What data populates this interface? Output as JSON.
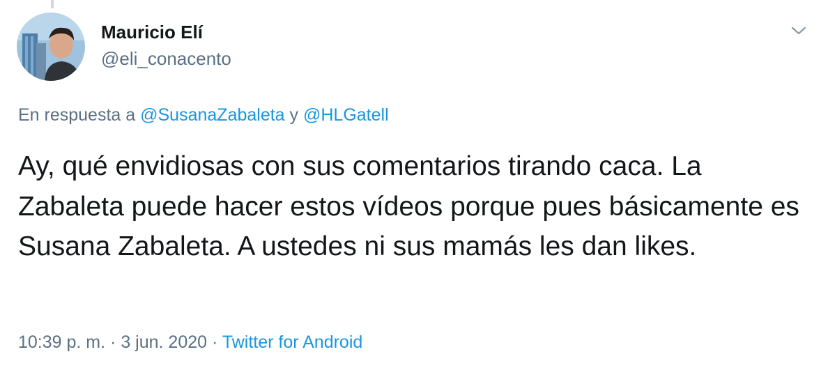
{
  "author": {
    "display_name": "Mauricio Elí",
    "handle": "@eli_conacento"
  },
  "reply": {
    "prefix": "En respuesta a",
    "mention_1": "@SusanaZabaleta",
    "conjunction": "y",
    "mention_2": "@HLGatell"
  },
  "tweet": {
    "text": "Ay, qué envidiosas con sus comentarios tirando caca. La Zabaleta puede hacer estos vídeos porque pues básicamente es Susana Zabaleta. A ustedes ni sus mamás les dan likes."
  },
  "meta": {
    "time": "10:39 p. m.",
    "separator": "·",
    "date": "3 jun. 2020",
    "source": "Twitter for Android"
  },
  "icons": {
    "caret": "chevron-down-icon",
    "avatar": "avatar-photo"
  },
  "colors": {
    "primary_text": "#14171a",
    "secondary_text": "#5b7083",
    "link": "#1b95e0",
    "thread_line": "#cfd9de"
  }
}
